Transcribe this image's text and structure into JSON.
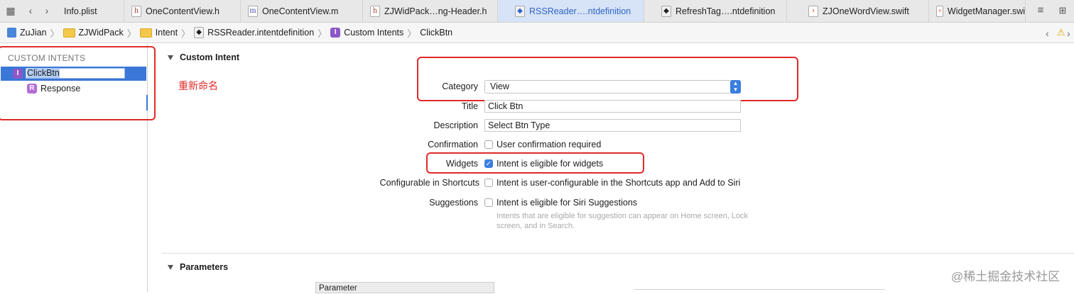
{
  "tabs": [
    {
      "label": "Info.plist",
      "icon": "none"
    },
    {
      "label": "OneContentView.h",
      "icon": "h"
    },
    {
      "label": "OneContentView.m",
      "icon": "m"
    },
    {
      "label": "ZJWidPack…ng-Header.h",
      "icon": "h"
    },
    {
      "label": "RSSReader….ntdefinition",
      "icon": "intentdefinition"
    },
    {
      "label": "RefreshTag….ntdefinition",
      "icon": "intentdefinition"
    },
    {
      "label": "ZJOneWordView.swift",
      "icon": "swift"
    },
    {
      "label": "WidgetManager.swi",
      "icon": "swift"
    }
  ],
  "breadcrumb": [
    "ZuJian",
    "ZJWidPack",
    "Intent",
    "RSSReader.intentdefinition",
    "Custom Intents",
    "ClickBtn"
  ],
  "sidebar": {
    "header": "CUSTOM INTENTS",
    "intent_name": "ClickBtn",
    "response_label": "Response",
    "intent_badge": "I",
    "response_badge": "R"
  },
  "annotation": "重新命名",
  "custom_intent": {
    "section_title": "Custom Intent",
    "category_label": "Category",
    "category_value": "View",
    "title_label": "Title",
    "title_value": "Click Btn",
    "description_label": "Description",
    "description_value": "Select Btn Type",
    "confirmation_label": "Confirmation",
    "confirmation_text": "User confirmation required",
    "confirmation_checked": false,
    "widgets_label": "Widgets",
    "widgets_text": "Intent is eligible for widgets",
    "widgets_checked": true,
    "shortcuts_label": "Configurable in Shortcuts",
    "shortcuts_text": "Intent is user-configurable in the Shortcuts app and Add to Siri",
    "shortcuts_checked": false,
    "suggestions_label": "Suggestions",
    "suggestions_text": "Intent is eligible for Siri Suggestions",
    "suggestions_checked": false,
    "suggestions_hint": "Intents that are eligible for suggestion can appear on Home screen, Lock screen, and in Search."
  },
  "parameters": {
    "section_title": "Parameters",
    "table_header": "Parameter"
  },
  "watermark": "@稀土掘金技术社区",
  "colors": {
    "accent": "#3a77d7",
    "annotation_red": "#e02a2a"
  }
}
